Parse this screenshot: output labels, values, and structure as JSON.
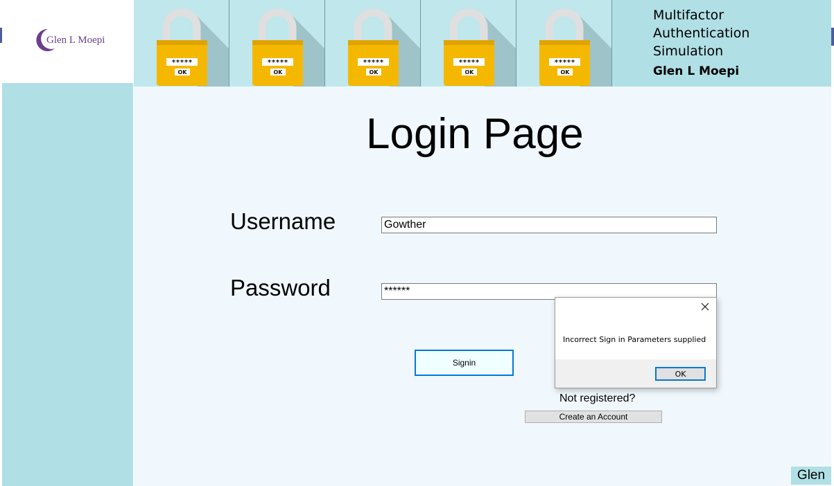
{
  "brand": {
    "logo_text": "Glen L Moepi"
  },
  "header": {
    "title_lines": [
      "Multifactor",
      "Authentication",
      "Simulation"
    ],
    "author": "Glen L Moepi",
    "lock_password_mask": "*****",
    "lock_ok_label": "OK",
    "lock_count": 5
  },
  "main": {
    "page_title": "Login Page",
    "username_label": "Username",
    "username_value": "Gowther",
    "password_label": "Password",
    "password_value": "******",
    "signin_label": "Signin",
    "not_registered": "Not registered?",
    "create_account_label": "Create an Account",
    "corner_tag": "Glen"
  },
  "dialog": {
    "message": "Incorrect Sign in Parameters supplied",
    "ok_label": "OK"
  },
  "colors": {
    "panel": "#b0dfe5",
    "main_bg": "#f0f8fd",
    "lock_body": "#f5b800",
    "accent": "#0078d7",
    "logo": "#6b3f8f"
  }
}
